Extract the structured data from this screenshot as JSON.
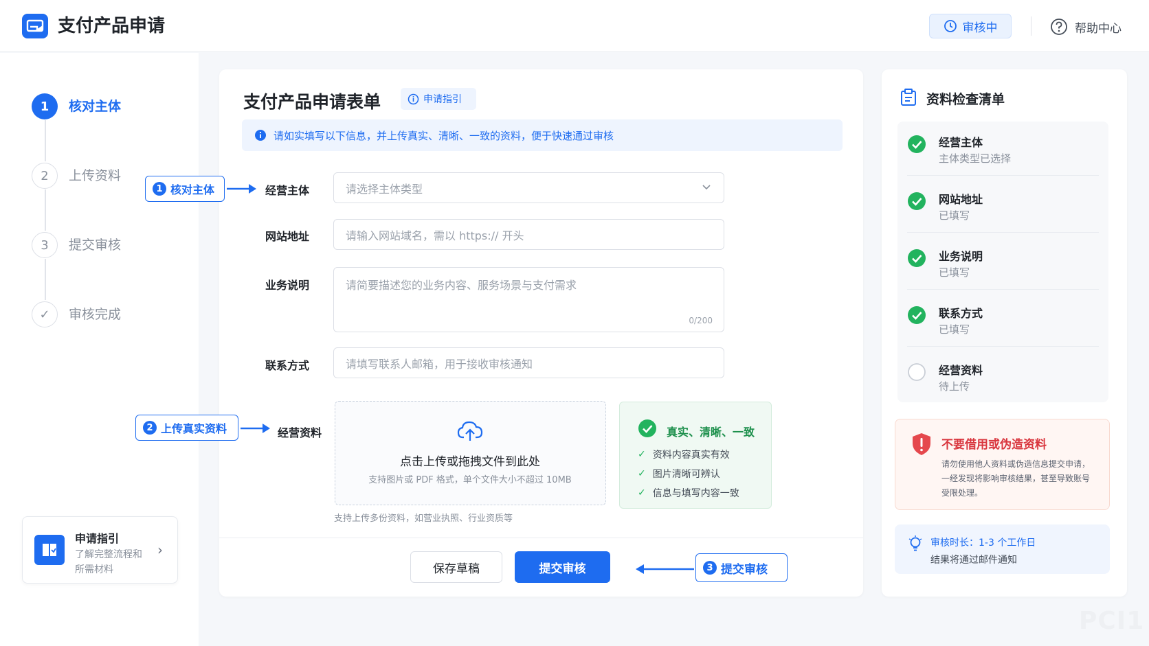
{
  "header": {
    "title": "支付产品申请",
    "status": "审核中",
    "help": "帮助中心"
  },
  "steps": [
    {
      "num": "1",
      "label": "核对主体",
      "state": "active"
    },
    {
      "num": "2",
      "label": "上传资料",
      "state": "pending"
    },
    {
      "num": "3",
      "label": "提交审核",
      "state": "pending"
    },
    {
      "num": "✓",
      "label": "审核完成",
      "state": "pending"
    }
  ],
  "guide_card": {
    "title": "申请指引",
    "desc1": "了解完整流程和",
    "desc2": "所需材料"
  },
  "form": {
    "title": "支付产品申请表单",
    "guide_link": "申请指引",
    "notice": "请如实填写以下信息，并上传真实、清晰、一致的资料，便于快速通过审核",
    "entity_label": "经营主体",
    "entity_placeholder": "请选择主体类型",
    "website_label": "网站地址",
    "website_placeholder": "请输入网站域名，需以 https:// 开头",
    "business_label": "业务说明",
    "business_placeholder": "请简要描述您的业务内容、服务场景与支付需求",
    "char_count": "0/200",
    "contact_label": "联系方式",
    "contact_placeholder": "请填写联系人邮箱，用于接收审核通知",
    "docs_label": "经营资料",
    "upload_title": "点击上传或拖拽文件到此处",
    "upload_hint": "支持图片或 PDF 格式，单个文件大小不超过 10MB",
    "upload_note": "支持上传多份资料，如营业执照、行业资质等",
    "tips_title": "真实、清晰、一致",
    "tips": [
      "资料内容真实有效",
      "图片清晰可辨认",
      "信息与填写内容一致"
    ],
    "save_btn": "保存草稿",
    "submit_btn": "提交审核"
  },
  "callouts": {
    "c1_num": "1",
    "c1_text": "核对主体",
    "c2_num": "2",
    "c2_text": "上传真实资料",
    "c3_num": "3",
    "c3_text": "提交审核"
  },
  "checklist": {
    "title": "资料检查清单",
    "items": [
      {
        "title": "经营主体",
        "sub": "主体类型已选择",
        "done": true
      },
      {
        "title": "网站地址",
        "sub": "已填写",
        "done": true
      },
      {
        "title": "业务说明",
        "sub": "已填写",
        "done": true
      },
      {
        "title": "联系方式",
        "sub": "已填写",
        "done": true
      },
      {
        "title": "经营资料",
        "sub": "待上传",
        "done": false
      }
    ]
  },
  "warning": {
    "title": "不要借用或伪造资料",
    "body1": "请勿使用他人资料或伪造信息提交申请，",
    "body2": "一经发现将影响审核结果，甚至导致账号",
    "body3": "受限处理。"
  },
  "review_info": {
    "line1": "审核时长：1-3 个工作日",
    "line2": "结果将通过邮件通知"
  },
  "watermark": "PCI1",
  "colors": {
    "accent": "#1e6cf0",
    "success": "#22b35e",
    "danger": "#e5484d"
  }
}
